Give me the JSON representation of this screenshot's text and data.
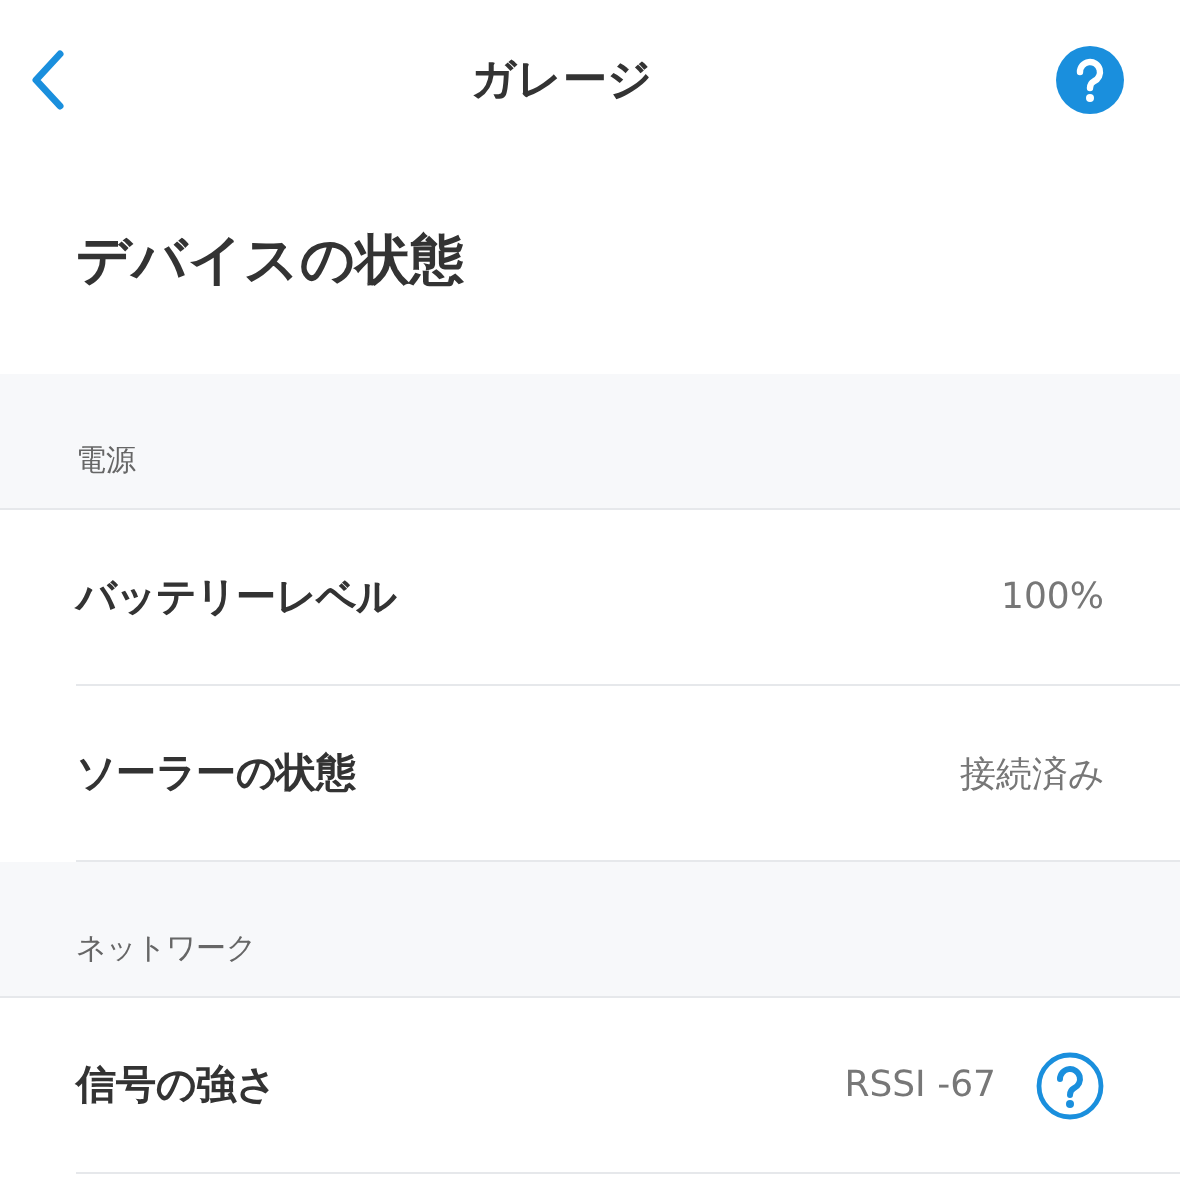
{
  "header": {
    "title": "ガレージ"
  },
  "page_title": "デバイスの状態",
  "sections": [
    {
      "title": "電源",
      "rows": [
        {
          "label": "バッテリーレベル",
          "value": "100%",
          "help": false
        },
        {
          "label": "ソーラーの状態",
          "value": "接続済み",
          "help": false
        }
      ]
    },
    {
      "title": "ネットワーク",
      "rows": [
        {
          "label": "信号の強さ",
          "value": "RSSI -67",
          "help": true
        }
      ]
    }
  ]
}
